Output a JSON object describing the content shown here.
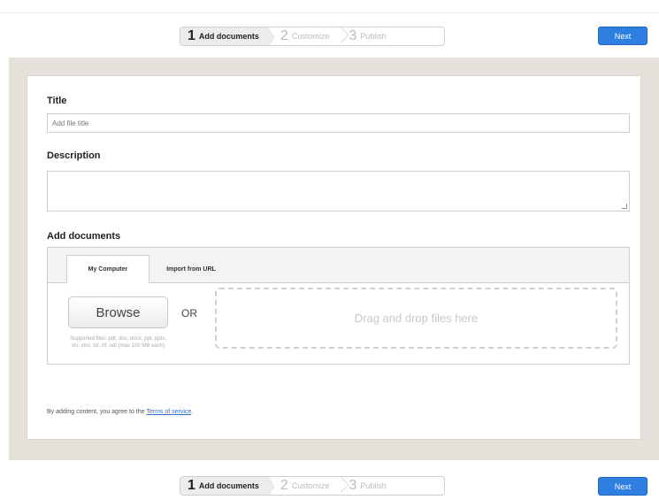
{
  "wizard": {
    "steps": [
      {
        "num": "1",
        "label": "Add documents"
      },
      {
        "num": "2",
        "label": "Customize"
      },
      {
        "num": "3",
        "label": "Publish"
      }
    ],
    "active_step": 1,
    "next_label": "Next"
  },
  "form": {
    "title_label": "Title",
    "title_placeholder": "Add file title",
    "description_label": "Description",
    "add_documents_label": "Add documents",
    "tabs": [
      {
        "label": "My Computer",
        "active": true
      },
      {
        "label": "Import from URL",
        "active": false
      }
    ],
    "browse_label": "Browse",
    "or_label": "OR",
    "accepted_formats": "Supported files: pdf, doc, docx, ppt, pptx, xls, xlsx, txt, rtf, odt (max 100 MB each)",
    "drop_label": "Drag and drop files here"
  },
  "footer": {
    "tos_prefix": "By adding content, you agree to the",
    "tos_link": "Terms of service",
    "tos_suffix": "."
  },
  "colors": {
    "accent": "#2f7fe0",
    "frame_bg": "#e4e1da",
    "link": "#2f6fd0"
  }
}
